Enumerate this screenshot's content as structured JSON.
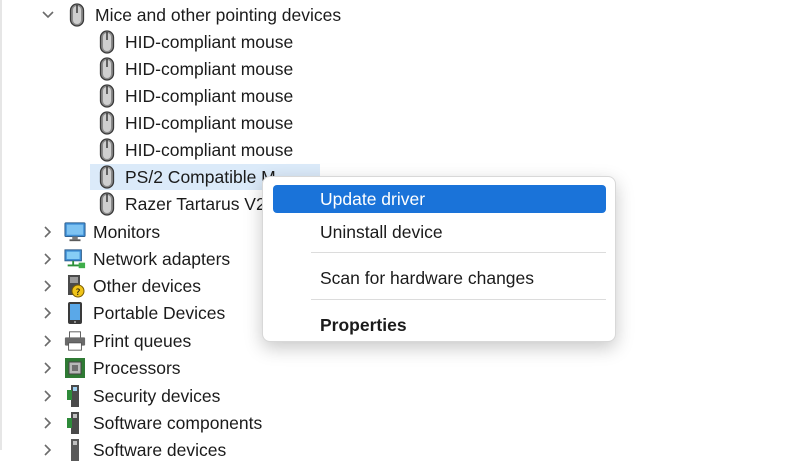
{
  "tree": {
    "mice_category": "Mice and other pointing devices",
    "mice_children": [
      "HID-compliant mouse",
      "HID-compliant mouse",
      "HID-compliant mouse",
      "HID-compliant mouse",
      "HID-compliant mouse",
      "PS/2 Compatible M",
      "Razer Tartarus V2"
    ],
    "categories": [
      {
        "label": "Monitors",
        "icon": "monitor-icon"
      },
      {
        "label": "Network adapters",
        "icon": "network-adapter-icon"
      },
      {
        "label": "Other devices",
        "icon": "other-devices-icon"
      },
      {
        "label": "Portable Devices",
        "icon": "portable-device-icon"
      },
      {
        "label": "Print queues",
        "icon": "printer-icon"
      },
      {
        "label": "Processors",
        "icon": "processor-icon"
      },
      {
        "label": "Security devices",
        "icon": "security-device-icon"
      },
      {
        "label": "Software components",
        "icon": "software-component-icon"
      },
      {
        "label": "Software devices",
        "icon": "software-device-icon"
      }
    ]
  },
  "context_menu": {
    "update_driver": "Update driver",
    "uninstall_device": "Uninstall device",
    "scan_hardware": "Scan for hardware changes",
    "properties": "Properties"
  },
  "colors": {
    "highlight": "#1a73d9",
    "selection": "#dbeaf9"
  }
}
